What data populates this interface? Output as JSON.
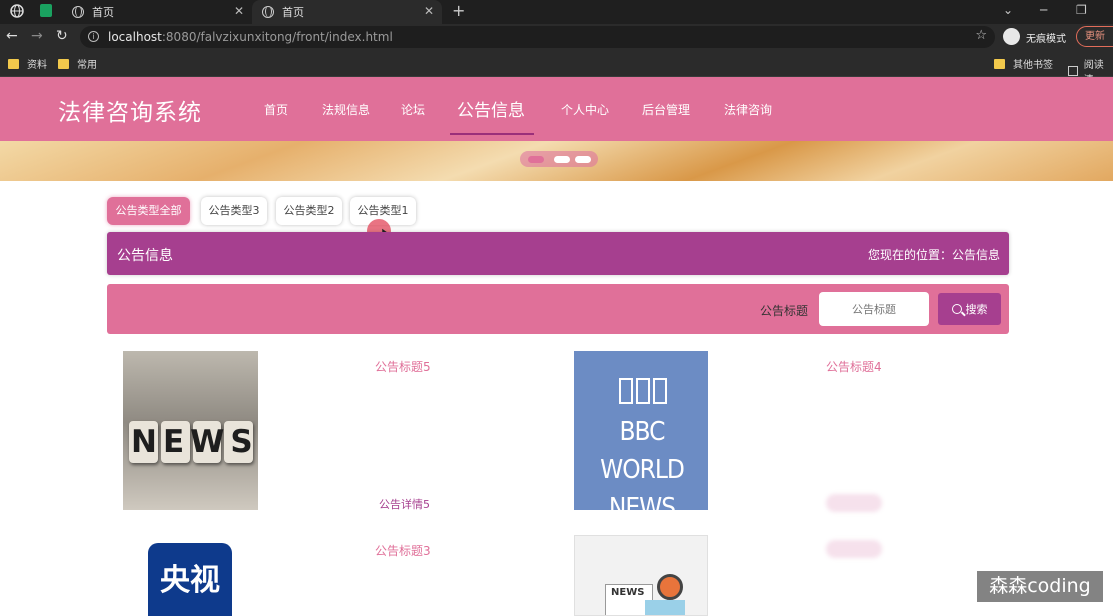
{
  "browser": {
    "tabs": [
      {
        "label": "首页",
        "active": false
      },
      {
        "label": "首页",
        "active": true
      }
    ],
    "url_host": "localhost",
    "url_rest": ":8080/falvzixunxitong/front/index.html",
    "incognito_label": "无痕模式",
    "update_label": "更新",
    "bookmarks": [
      "资料",
      "常用"
    ],
    "bookmarks_right": [
      "其他书签",
      "阅读清"
    ]
  },
  "site": {
    "brand": "法律咨询系统",
    "nav": [
      "首页",
      "法规信息",
      "论坛",
      "公告信息",
      "个人中心",
      "后台管理",
      "法律咨询"
    ],
    "active_nav_index": 3
  },
  "filters": {
    "chips": [
      "公告类型全部",
      "公告类型3",
      "公告类型2",
      "公告类型1"
    ],
    "active_index": 0
  },
  "section": {
    "title": "公告信息",
    "breadcrumb": "您现在的位置：公告信息"
  },
  "search": {
    "label": "公告标题",
    "placeholder": "公告标题",
    "button": "搜索"
  },
  "cards": [
    {
      "title": "公告标题5",
      "detail": "公告详情5",
      "image_text": "NEWS"
    },
    {
      "title": "公告标题4",
      "detail": "",
      "image_text": "BBC WORLD NEWS"
    },
    {
      "title": "公告标题3",
      "detail": "",
      "image_text": "央视"
    },
    {
      "title": "",
      "detail": "",
      "image_text": "NEWS"
    }
  ],
  "watermark": "森森coding",
  "colors": {
    "primary": "#e07099",
    "secondary": "#a63f8f"
  }
}
